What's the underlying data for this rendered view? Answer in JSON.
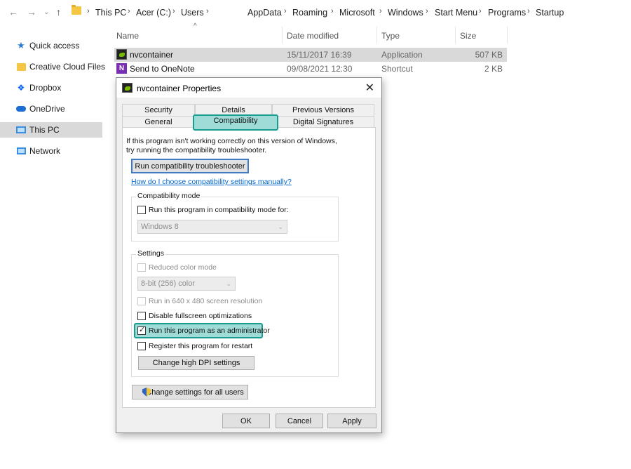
{
  "address": {
    "crumbs": [
      "This PC",
      "Acer (C:)",
      "Users",
      "AppData",
      "Roaming",
      "Microsoft",
      "Windows",
      "Start Menu",
      "Programs",
      "Startup"
    ]
  },
  "sidebar": {
    "items": [
      {
        "label": "Quick access",
        "icon": "star-icon"
      },
      {
        "label": "Creative Cloud Files",
        "icon": "folder-icon"
      },
      {
        "label": "Dropbox",
        "icon": "dropbox-icon"
      },
      {
        "label": "OneDrive",
        "icon": "cloud-icon"
      },
      {
        "label": "This PC",
        "icon": "computer-icon"
      },
      {
        "label": "Network",
        "icon": "network-icon"
      }
    ]
  },
  "filelist": {
    "columns": {
      "name": "Name",
      "date": "Date modified",
      "type": "Type",
      "size": "Size"
    },
    "rows": [
      {
        "name": "nvcontainer",
        "date": "15/11/2017 16:39",
        "type": "Application",
        "size": "507 KB"
      },
      {
        "name": "Send to OneNote",
        "date": "09/08/2021 12:30",
        "type": "Shortcut",
        "size": "2 KB"
      }
    ]
  },
  "dialog": {
    "title": "nvcontainer Properties",
    "close": "✕",
    "tabs": {
      "security": "Security",
      "details": "Details",
      "previous": "Previous Versions",
      "general": "General",
      "compat": "Compatibility",
      "digsig": "Digital Signatures"
    },
    "intro_line1": "If this program isn't working correctly on this version of Windows,",
    "intro_line2": "try running the compatibility troubleshooter.",
    "troubleshoot_btn": "Run compatibility troubleshooter",
    "help_link": "How do I choose compatibility settings manually?",
    "compat_mode": {
      "label": "Compatibility mode",
      "checkbox": "Run this program in compatibility mode for:",
      "select": "Windows 8"
    },
    "settings": {
      "label": "Settings",
      "reduced_color": "Reduced color mode",
      "color_select": "8-bit (256) color",
      "res640": "Run in 640 x 480 screen resolution",
      "fullscreen": "Disable fullscreen optimizations",
      "admin": "Run this program as an administrator",
      "restart": "Register this program for restart",
      "dpi_btn": "Change high DPI settings"
    },
    "all_users_btn": "Change settings for all users",
    "ok": "OK",
    "cancel": "Cancel",
    "apply": "Apply"
  }
}
